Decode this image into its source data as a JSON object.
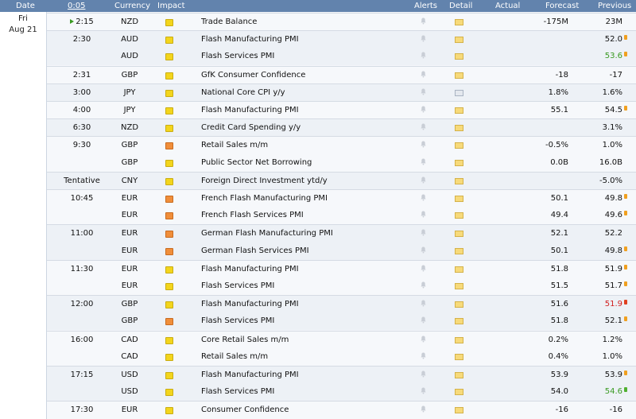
{
  "header": {
    "date": "Date",
    "time": "0:05",
    "currency": "Currency",
    "impact": "Impact",
    "alerts": "Alerts",
    "detail": "Detail",
    "actual": "Actual",
    "forecast": "Forecast",
    "previous": "Previous"
  },
  "date": {
    "day": "Fri",
    "month_day": "Aug 21"
  },
  "colors": {
    "header_bg": "#6283ad",
    "impact_low": "#f3d51c",
    "impact_medium": "#f08e3a",
    "better": "#3a9a22",
    "worse": "#d11f1f"
  },
  "rows": [
    {
      "time": "2:15",
      "currency": "NZD",
      "impact": "low",
      "event": "Trade Balance",
      "detail_icon": "folder-icon",
      "actual": "",
      "forecast": "-175M",
      "previous": "23M",
      "prev_color": "",
      "mark": ""
    },
    {
      "time": "2:30",
      "currency": "AUD",
      "impact": "low",
      "event": "Flash Manufacturing PMI",
      "detail_icon": "folder-icon",
      "actual": "",
      "forecast": "",
      "previous": "52.0",
      "prev_color": "",
      "mark": "orange"
    },
    {
      "time": "",
      "currency": "AUD",
      "impact": "low",
      "event": "Flash Services PMI",
      "detail_icon": "folder-icon",
      "actual": "",
      "forecast": "",
      "previous": "53.6",
      "prev_color": "green",
      "mark": "orange"
    },
    {
      "time": "2:31",
      "currency": "GBP",
      "impact": "low",
      "event": "GfK Consumer Confidence",
      "detail_icon": "folder-icon",
      "actual": "",
      "forecast": "-18",
      "previous": "-17",
      "prev_color": "",
      "mark": ""
    },
    {
      "time": "3:00",
      "currency": "JPY",
      "impact": "low",
      "event": "National Core CPI y/y",
      "detail_icon": "note-icon",
      "actual": "",
      "forecast": "1.8%",
      "previous": "1.6%",
      "prev_color": "",
      "mark": ""
    },
    {
      "time": "4:00",
      "currency": "JPY",
      "impact": "low",
      "event": "Flash Manufacturing PMI",
      "detail_icon": "folder-icon",
      "actual": "",
      "forecast": "55.1",
      "previous": "54.5",
      "prev_color": "",
      "mark": "orange"
    },
    {
      "time": "6:30",
      "currency": "NZD",
      "impact": "low",
      "event": "Credit Card Spending y/y",
      "detail_icon": "folder-icon",
      "actual": "",
      "forecast": "",
      "previous": "3.1%",
      "prev_color": "",
      "mark": ""
    },
    {
      "time": "9:30",
      "currency": "GBP",
      "impact": "medium",
      "event": "Retail Sales m/m",
      "detail_icon": "folder-icon",
      "actual": "",
      "forecast": "-0.5%",
      "previous": "1.0%",
      "prev_color": "",
      "mark": ""
    },
    {
      "time": "",
      "currency": "GBP",
      "impact": "low",
      "event": "Public Sector Net Borrowing",
      "detail_icon": "folder-icon",
      "actual": "",
      "forecast": "0.0B",
      "previous": "16.0B",
      "prev_color": "",
      "mark": ""
    },
    {
      "time": "Tentative",
      "currency": "CNY",
      "impact": "low",
      "event": "Foreign Direct Investment ytd/y",
      "detail_icon": "folder-icon",
      "actual": "",
      "forecast": "",
      "previous": "-5.0%",
      "prev_color": "",
      "mark": ""
    },
    {
      "time": "10:45",
      "currency": "EUR",
      "impact": "medium",
      "event": "French Flash Manufacturing PMI",
      "detail_icon": "folder-icon",
      "actual": "",
      "forecast": "50.1",
      "previous": "49.8",
      "prev_color": "",
      "mark": "orange"
    },
    {
      "time": "",
      "currency": "EUR",
      "impact": "medium",
      "event": "French Flash Services PMI",
      "detail_icon": "folder-icon",
      "actual": "",
      "forecast": "49.4",
      "previous": "49.6",
      "prev_color": "",
      "mark": "orange"
    },
    {
      "time": "11:00",
      "currency": "EUR",
      "impact": "medium",
      "event": "German Flash Manufacturing PMI",
      "detail_icon": "folder-icon",
      "actual": "",
      "forecast": "52.1",
      "previous": "52.2",
      "prev_color": "",
      "mark": ""
    },
    {
      "time": "",
      "currency": "EUR",
      "impact": "medium",
      "event": "German Flash Services PMI",
      "detail_icon": "folder-icon",
      "actual": "",
      "forecast": "50.1",
      "previous": "49.8",
      "prev_color": "",
      "mark": "orange"
    },
    {
      "time": "11:30",
      "currency": "EUR",
      "impact": "low",
      "event": "Flash Manufacturing PMI",
      "detail_icon": "folder-icon",
      "actual": "",
      "forecast": "51.8",
      "previous": "51.9",
      "prev_color": "",
      "mark": "orange"
    },
    {
      "time": "",
      "currency": "EUR",
      "impact": "low",
      "event": "Flash Services PMI",
      "detail_icon": "folder-icon",
      "actual": "",
      "forecast": "51.5",
      "previous": "51.7",
      "prev_color": "",
      "mark": "orange"
    },
    {
      "time": "12:00",
      "currency": "GBP",
      "impact": "low",
      "event": "Flash Manufacturing PMI",
      "detail_icon": "folder-icon",
      "actual": "",
      "forecast": "51.6",
      "previous": "51.9",
      "prev_color": "red",
      "mark": "red"
    },
    {
      "time": "",
      "currency": "GBP",
      "impact": "medium",
      "event": "Flash Services PMI",
      "detail_icon": "folder-icon",
      "actual": "",
      "forecast": "51.8",
      "previous": "52.1",
      "prev_color": "",
      "mark": "orange"
    },
    {
      "time": "16:00",
      "currency": "CAD",
      "impact": "low",
      "event": "Core Retail Sales m/m",
      "detail_icon": "folder-icon",
      "actual": "",
      "forecast": "0.2%",
      "previous": "1.2%",
      "prev_color": "",
      "mark": ""
    },
    {
      "time": "",
      "currency": "CAD",
      "impact": "low",
      "event": "Retail Sales m/m",
      "detail_icon": "folder-icon",
      "actual": "",
      "forecast": "0.4%",
      "previous": "1.0%",
      "prev_color": "",
      "mark": ""
    },
    {
      "time": "17:15",
      "currency": "USD",
      "impact": "low",
      "event": "Flash Manufacturing PMI",
      "detail_icon": "folder-icon",
      "actual": "",
      "forecast": "53.9",
      "previous": "53.9",
      "prev_color": "",
      "mark": "orange"
    },
    {
      "time": "",
      "currency": "USD",
      "impact": "low",
      "event": "Flash Services PMI",
      "detail_icon": "folder-icon",
      "actual": "",
      "forecast": "54.0",
      "previous": "54.6",
      "prev_color": "green",
      "mark": "green"
    },
    {
      "time": "17:30",
      "currency": "EUR",
      "impact": "low",
      "event": "Consumer Confidence",
      "detail_icon": "folder-icon",
      "actual": "",
      "forecast": "-16",
      "previous": "-16",
      "prev_color": "",
      "mark": ""
    }
  ]
}
